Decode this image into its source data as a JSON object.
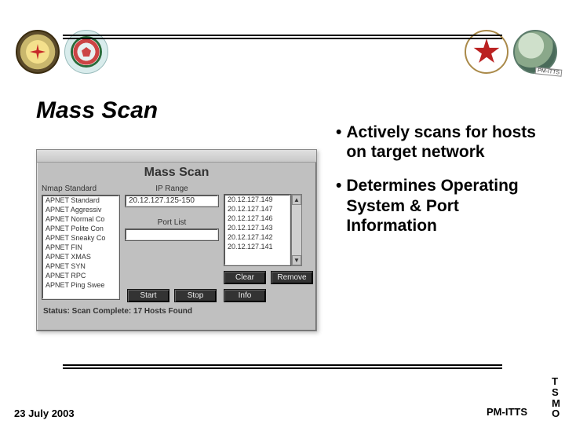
{
  "slide": {
    "title": "Mass Scan",
    "bullets": [
      "Actively scans for hosts on target network",
      "Determines Operating System & Port Information"
    ],
    "footer_date": "23 July 2003",
    "footer_right": "PM-ITTS",
    "tsmo": [
      "T",
      "S",
      "M",
      "O"
    ]
  },
  "shot": {
    "window_title": "Mass Scan",
    "nmap_label": "Nmap Standard",
    "iprange_label": "IP Range",
    "portlist_label": "Port List",
    "ip_value": "20.12.127.125-150",
    "port_value": "",
    "nmap_items": [
      "APNET Standard",
      "APNET Aggressiv",
      "APNET Normal Co",
      "APNET Polite Con",
      "APNET Sneaky Co",
      "APNET FIN",
      "APNET XMAS",
      "APNET SYN",
      "APNET RPC",
      "APNET Ping Swee"
    ],
    "result_items": [
      "20.12.127.149",
      "20.12.127.147",
      "20.12.127.146",
      "20.12.127.143",
      "20.12.127.142",
      "20.12.127.141"
    ],
    "buttons": {
      "start": "Start",
      "stop": "Stop",
      "clear": "Clear",
      "remove": "Remove",
      "info": "Info"
    },
    "status": "Status:  Scan Complete: 17 Hosts Found"
  }
}
